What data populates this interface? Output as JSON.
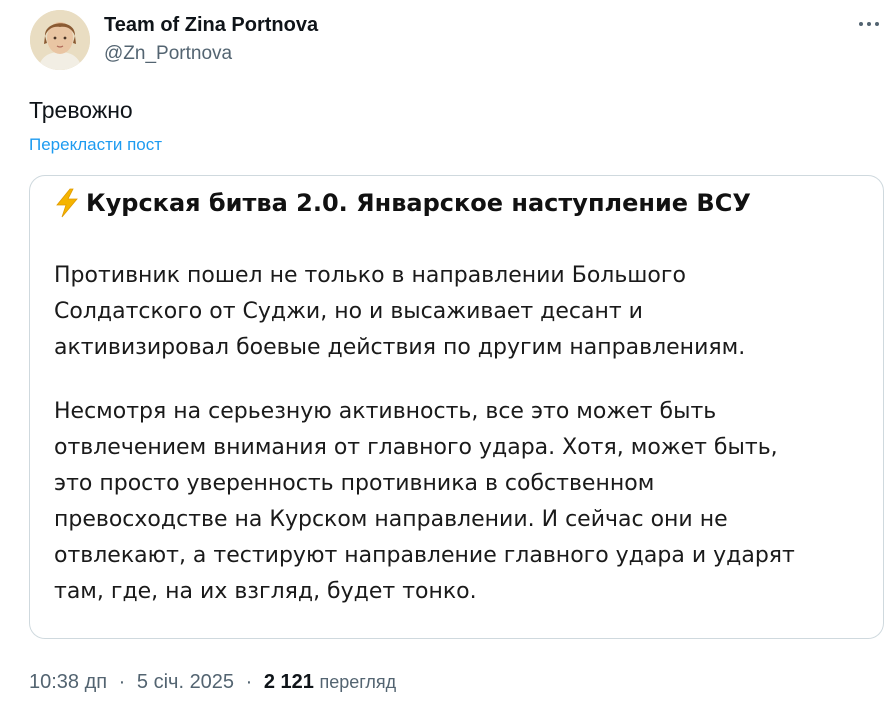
{
  "author": {
    "name": "Team of Zina Portnova",
    "handle": "@Zn_Portnova"
  },
  "tweet": {
    "text": "Тревожно",
    "translate_label": "Перекласти пост"
  },
  "card": {
    "title": "Курская битва 2.0. Январское наступление ВСУ",
    "title_icon": "lightning-icon",
    "paragraphs": [
      "Противник пошел не только в направлении Большого\nСолдатского от Суджи, но и высаживает десант и\nактивизировал боевые действия по другим направлениям.",
      "Несмотря на серьезную активность, все это может быть\nотвлечением внимания от главного удара. Хотя, может быть,\nэто просто уверенность противника в собственном\nпревосходстве на Курском направлении. И сейчас они не\nотвлекают, а тестируют направление главного удара и ударят\nтам, где, на их взгляд, будет тонко."
    ]
  },
  "meta": {
    "time": "10:38 дп",
    "separator": "·",
    "date": "5 січ. 2025",
    "views_count": "2 121",
    "views_label": "перегляд"
  },
  "colors": {
    "accent": "#1d9bf0",
    "secondary_text": "#536471",
    "border": "#cfd9de",
    "bolt": "#f5b400"
  }
}
